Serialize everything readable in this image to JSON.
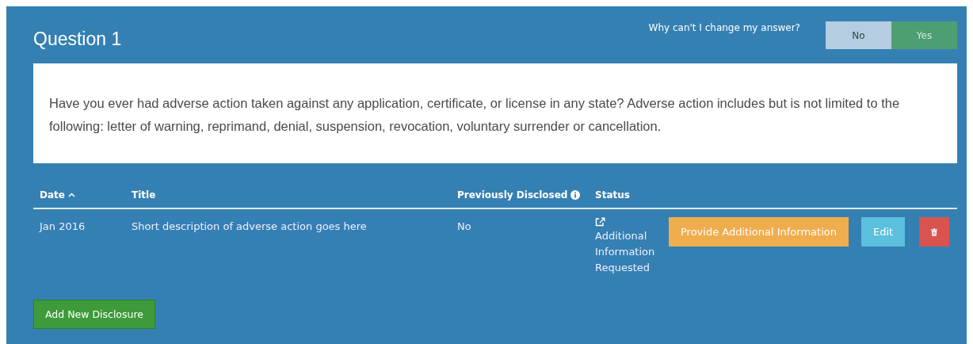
{
  "title": "Question 1",
  "help_link": "Why can't I change my answer?",
  "answer_toggle": [
    {
      "label": "No",
      "selected": false
    },
    {
      "label": "Yes",
      "selected": true
    }
  ],
  "question_text": "Have you ever had adverse action taken against any application, certificate, or license in any state? Adverse action includes but is not limited to the following: letter of warning, reprimand, denial, suspension, revocation, voluntary surrender or cancellation.",
  "table": {
    "columns": [
      {
        "label": "Date",
        "sort_ascending": true,
        "info": false
      },
      {
        "label": "Title",
        "sort_ascending": false,
        "info": false
      },
      {
        "label": "Previously Disclosed",
        "sort_ascending": false,
        "info": true
      },
      {
        "label": "Status",
        "sort_ascending": false,
        "info": false
      }
    ],
    "rows": [
      {
        "date": "Jan 2016",
        "title": "Short description of adverse action goes here",
        "previously_disclosed": "No",
        "status": "Additional Information Requested",
        "actions": [
          {
            "kind": "provide",
            "label": "Provide Additional Information"
          },
          {
            "kind": "edit",
            "label": "Edit"
          },
          {
            "kind": "delete"
          }
        ]
      }
    ]
  },
  "add_button": "Add New Disclosure"
}
